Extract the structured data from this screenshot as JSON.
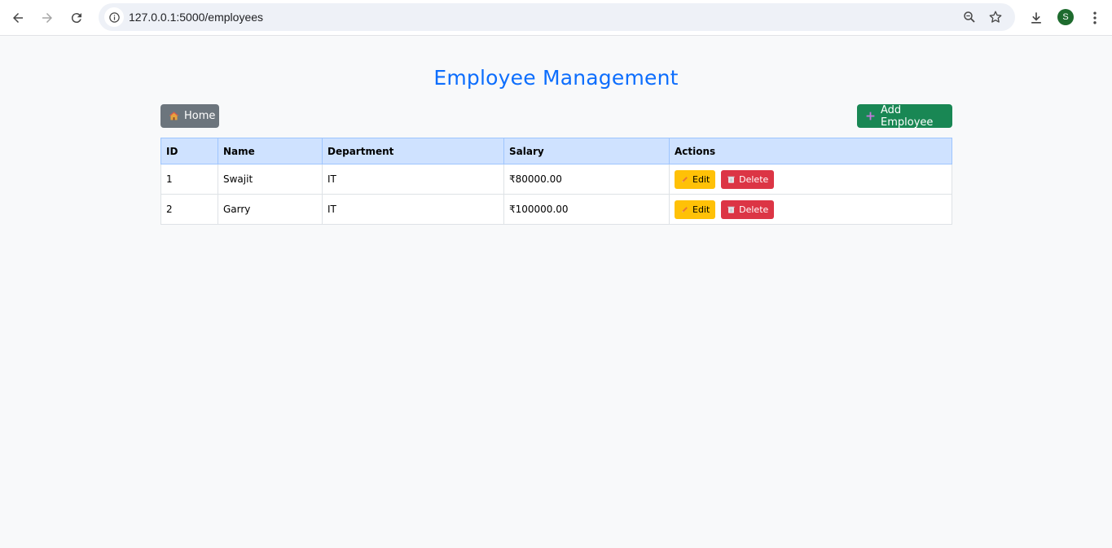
{
  "browser": {
    "url": "127.0.0.1:5000/employees",
    "profile_initial": "S"
  },
  "page": {
    "title": "Employee Management",
    "home_label": "Home",
    "add_label": "Add Employee"
  },
  "table": {
    "headers": [
      "ID",
      "Name",
      "Department",
      "Salary",
      "Actions"
    ],
    "rows": [
      {
        "id": "1",
        "name": "Swajit",
        "department": "IT",
        "salary": "₹80000.00"
      },
      {
        "id": "2",
        "name": "Garry",
        "department": "IT",
        "salary": "₹100000.00"
      }
    ],
    "edit_label": "Edit",
    "delete_label": "Delete"
  },
  "colors": {
    "title": "#0d6efd",
    "home_button": "#6c757d",
    "add_button": "#198754",
    "header_bg": "#cfe2ff",
    "edit_button": "#ffc107",
    "delete_button": "#dc3545"
  }
}
